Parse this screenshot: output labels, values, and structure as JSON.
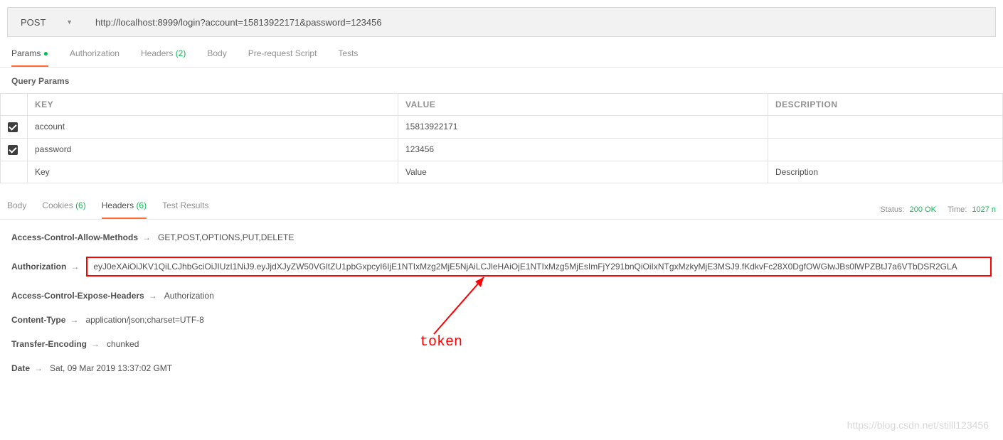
{
  "request": {
    "method": "POST",
    "url": "http://localhost:8999/login?account=15813922171&password=123456"
  },
  "tabs": {
    "params": "Params",
    "authorization": "Authorization",
    "headers": "Headers",
    "headers_count": "(2)",
    "body": "Body",
    "prerequest": "Pre-request Script",
    "tests": "Tests"
  },
  "query_section": {
    "title": "Query Params",
    "cols": {
      "key": "KEY",
      "value": "VALUE",
      "desc": "DESCRIPTION"
    },
    "rows": [
      {
        "key": "account",
        "value": "15813922171"
      },
      {
        "key": "password",
        "value": "123456"
      }
    ],
    "placeholders": {
      "key": "Key",
      "value": "Value",
      "desc": "Description"
    }
  },
  "response": {
    "tabs": {
      "body": "Body",
      "cookies": "Cookies",
      "cookies_count": "(6)",
      "headers": "Headers",
      "headers_count": "(6)",
      "tests": "Test Results"
    },
    "status_label": "Status:",
    "status_value": "200 OK",
    "time_label": "Time:",
    "time_value": "1027 n",
    "headers": [
      {
        "key": "Access-Control-Allow-Methods",
        "value": "GET,POST,OPTIONS,PUT,DELETE"
      },
      {
        "key": "Authorization",
        "value": "eyJ0eXAiOiJKV1QiLCJhbGciOiJIUzI1NiJ9.eyJjdXJyZW50VGltZU1pbGxpcyI6IjE1NTIxMzg2MjE5NjAiLCJleHAiOjE1NTIxMzg5MjEsImFjY291bnQiOiIxNTgxMzkyMjE3MSJ9.fKdkvFc28X0DgfOWGlwJBs0lWPZBtJ7a6VTbDSR2GLA",
        "boxed": true
      },
      {
        "key": "Access-Control-Expose-Headers",
        "value": "Authorization"
      },
      {
        "key": "Content-Type",
        "value": "application/json;charset=UTF-8"
      },
      {
        "key": "Transfer-Encoding",
        "value": "chunked"
      },
      {
        "key": "Date",
        "value": "Sat, 09 Mar 2019 13:37:02 GMT"
      }
    ]
  },
  "annotation": "token",
  "watermark": "https://blog.csdn.net/stilll123456"
}
